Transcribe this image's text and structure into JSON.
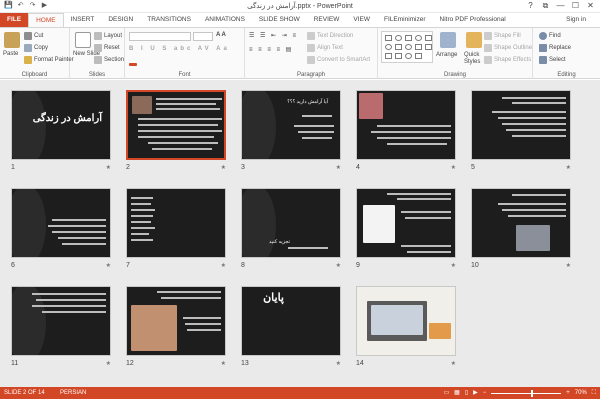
{
  "window": {
    "title": "آرامش در زندگی.pptx - PowerPoint",
    "controls": [
      "?",
      "⧉",
      "—",
      "☐",
      "✕"
    ]
  },
  "qat": [
    "💾",
    "↶",
    "↷",
    "▶"
  ],
  "tabs": [
    {
      "label": "FILE"
    },
    {
      "label": "HOME"
    },
    {
      "label": "INSERT"
    },
    {
      "label": "DESIGN"
    },
    {
      "label": "TRANSITIONS"
    },
    {
      "label": "ANIMATIONS"
    },
    {
      "label": "SLIDE SHOW"
    },
    {
      "label": "REVIEW"
    },
    {
      "label": "VIEW"
    },
    {
      "label": "FILEminimizer"
    },
    {
      "label": "Nitro PDF Professional"
    }
  ],
  "signin": "Sign in",
  "ribbon": {
    "clipboard": {
      "label": "Clipboard",
      "paste": "Paste",
      "cut": "Cut",
      "copy": "Copy",
      "format_painter": "Format Painter"
    },
    "slides": {
      "label": "Slides",
      "new_slide": "New Slide",
      "layout": "Layout",
      "reset": "Reset",
      "section": "Section"
    },
    "font": {
      "label": "Font"
    },
    "paragraph": {
      "label": "Paragraph",
      "text_direction": "Text Direction",
      "align_text": "Align Text",
      "convert_smartart": "Convert to SmartArt"
    },
    "drawing": {
      "label": "Drawing",
      "arrange": "Arrange",
      "quick_styles": "Quick Styles",
      "shape_fill": "Shape Fill",
      "shape_outline": "Shape Outline",
      "shape_effects": "Shape Effects"
    },
    "editing": {
      "label": "Editing",
      "find": "Find",
      "replace": "Replace",
      "select": "Select"
    }
  },
  "slides": [
    {
      "number": "1",
      "title": "آرامش در زندگی"
    },
    {
      "number": "2"
    },
    {
      "number": "3",
      "title": "آیا آرامش دارید ؟؟؟"
    },
    {
      "number": "4"
    },
    {
      "number": "5"
    },
    {
      "number": "6"
    },
    {
      "number": "7"
    },
    {
      "number": "8",
      "title": "تجزیه کنید"
    },
    {
      "number": "9",
      "title": "من برای زمینان به آرامش"
    },
    {
      "number": "10"
    },
    {
      "number": "11"
    },
    {
      "number": "12"
    },
    {
      "number": "13",
      "title": "پایان"
    },
    {
      "number": "14"
    }
  ],
  "status": {
    "slide": "SLIDE 2 OF 14",
    "language": "PERSIAN",
    "zoom": "70%"
  },
  "colors": {
    "accent": "#d24726",
    "slide_bg": "#1d1d1d"
  }
}
